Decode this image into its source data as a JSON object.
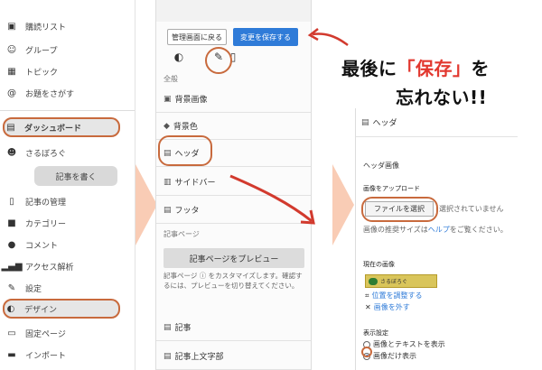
{
  "panel1": {
    "items": [
      {
        "label": "購読リスト",
        "icon": "book-icon"
      },
      {
        "label": "グループ",
        "icon": "group-icon"
      },
      {
        "label": "トピック",
        "icon": "grid-icon"
      },
      {
        "label": "お題をさがす",
        "icon": "at-icon"
      },
      {
        "label": "ダッシュボード",
        "icon": "dashboard-icon"
      },
      {
        "label": "さるぼろぐ",
        "icon": "monkey-icon"
      },
      {
        "label": "記事の管理",
        "icon": "document-icon"
      },
      {
        "label": "カテゴリー",
        "icon": "folder-icon"
      },
      {
        "label": "コメント",
        "icon": "comment-icon"
      },
      {
        "label": "アクセス解析",
        "icon": "bar-chart-icon"
      },
      {
        "label": "設定",
        "icon": "wrench-icon"
      },
      {
        "label": "デザイン",
        "icon": "palette-icon"
      },
      {
        "label": "固定ページ",
        "icon": "page-icon"
      },
      {
        "label": "インポート",
        "icon": "import-icon"
      }
    ],
    "write_button": "記事を書く"
  },
  "panel2": {
    "back_button": "管理画面に戻る",
    "save_button": "変更を保存する",
    "section_general": "全般",
    "items": {
      "bg_image": "背景画像",
      "bg_color": "背景色",
      "header": "ヘッダ",
      "sidebar": "サイドバー",
      "footer": "フッタ"
    },
    "section_article_page": "記事ページ",
    "preview_button": "記事ページをプレビュー",
    "help_text": "記事ページ ⓘ をカスタマイズします。確認するには、プレビューを切り替えてください。",
    "article_item": "記事",
    "last_item": "記事上文字部"
  },
  "annotation": {
    "line1_pre": "最後に",
    "line1_red": "「保存」",
    "line1_post": "を",
    "line2": "忘れない!!"
  },
  "panel3": {
    "title": "ヘッダ",
    "header_image": "ヘッダ画像",
    "upload_label": "画像をアップロード",
    "file_button": "ファイルを選択",
    "file_status": "選択されていません",
    "help_pre": "画像の推奨サイズは",
    "help_link": "ヘルプ",
    "help_post": "をご覧ください。",
    "current_image": "現在の画像",
    "thumb_text": "さるぼろぐ",
    "adjust_link": "位置を調整する",
    "remove_link": "画像を外す",
    "display_settings": "表示設定",
    "radio_options": [
      {
        "label": "画像とテキストを表示",
        "selected": false
      },
      {
        "label": "画像だけ表示",
        "selected": true
      }
    ]
  },
  "colors": {
    "highlight_ring": "#c86a3d",
    "save_button": "#2f7bd8",
    "annotation_red": "#e2382f",
    "arrow_red": "#d23a2e"
  }
}
